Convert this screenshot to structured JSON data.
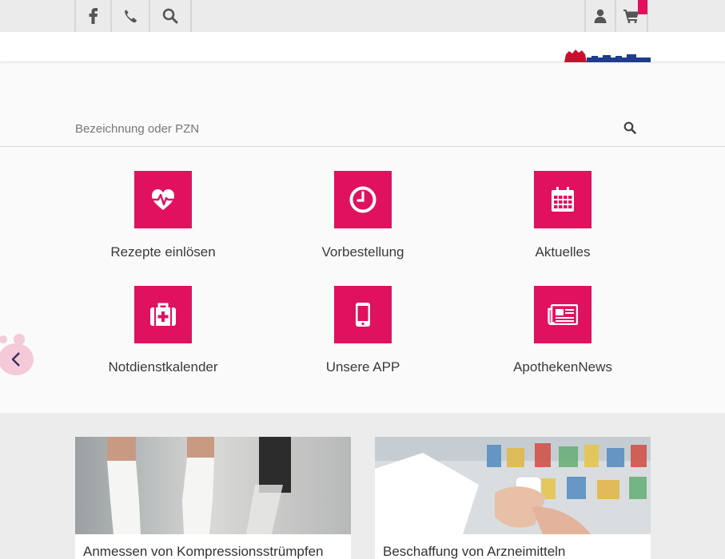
{
  "topbar": {
    "facebook_icon": "facebook-icon",
    "phone_icon": "phone-icon",
    "search_icon": "search-icon",
    "user_icon": "user-icon",
    "cart_icon": "cart-icon"
  },
  "search": {
    "placeholder": "Bezeichnung oder PZN"
  },
  "tiles": [
    {
      "label": "Rezepte einlösen",
      "icon": "heartbeat-icon"
    },
    {
      "label": "Vorbestellung",
      "icon": "clock-icon"
    },
    {
      "label": "Aktuelles",
      "icon": "calendar-icon"
    },
    {
      "label": "Notdienstkalender",
      "icon": "medkit-icon"
    },
    {
      "label": "Unsere APP",
      "icon": "mobile-icon"
    },
    {
      "label": "ApothekenNews",
      "icon": "newspaper-icon"
    }
  ],
  "cards": [
    {
      "title": "Anmessen von Kompressionsstrümpfen"
    },
    {
      "title": "Beschaffung von Arzneimitteln"
    }
  ],
  "colors": {
    "accent": "#e0115f",
    "topbar_bg": "#ebebeb",
    "lower_bg": "#ececec"
  }
}
